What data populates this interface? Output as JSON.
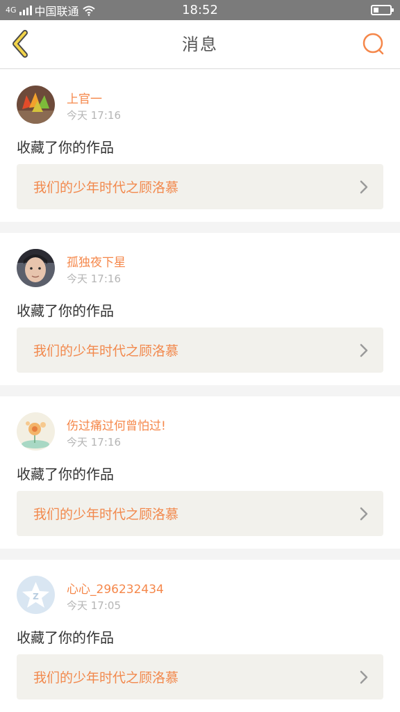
{
  "statusbar": {
    "carrier": "中国联通",
    "network": "4G",
    "time": "18:52",
    "battery_level": 0.3
  },
  "header": {
    "title": "消息",
    "back_icon": "chevron-left-icon",
    "search_icon": "search-icon"
  },
  "colors": {
    "accent": "#f5874a",
    "back": "#f2d44a",
    "card_bg": "#f2f1ec"
  },
  "messages": [
    {
      "username": "上官一",
      "time": "今天 17:16",
      "action": "收藏了你的作品",
      "work_title": "我们的少年时代之顾洛慕",
      "avatar": "leaf-avatar"
    },
    {
      "username": "孤独夜下星",
      "time": "今天 17:16",
      "action": "收藏了你的作品",
      "work_title": "我们的少年时代之顾洛慕",
      "avatar": "photo-avatar"
    },
    {
      "username": "伤过痛过何曾怕过!",
      "time": "今天 17:16",
      "action": "收藏了你的作品",
      "work_title": "我们的少年时代之顾洛慕",
      "avatar": "flower-avatar"
    },
    {
      "username": "心心_296232434",
      "time": "今天 17:05",
      "action": "收藏了你的作品",
      "work_title": "我们的少年时代之顾洛慕",
      "avatar": "qq-star-avatar"
    }
  ]
}
